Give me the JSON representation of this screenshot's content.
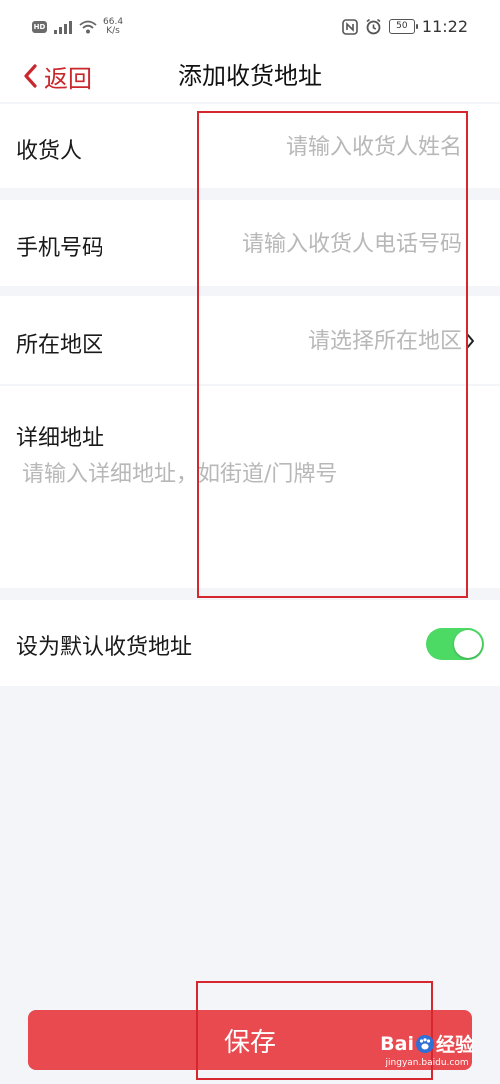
{
  "status_bar": {
    "hd_badge": "HD",
    "network_speed_value": "66.4",
    "network_speed_unit": "K/s",
    "battery": "50",
    "time": "11:22",
    "icons": [
      "hd-icon",
      "signal-icon",
      "wifi-icon",
      "nfc-icon",
      "alarm-icon",
      "battery-icon"
    ]
  },
  "nav": {
    "back_label": "返回",
    "title": "添加收货地址"
  },
  "form": {
    "recipient": {
      "label": "收货人",
      "placeholder": "请输入收货人姓名",
      "value": ""
    },
    "phone": {
      "label": "手机号码",
      "placeholder": "请输入收货人电话号码",
      "value": ""
    },
    "region": {
      "label": "所在地区",
      "placeholder": "请选择所在地区",
      "value": ""
    },
    "detail": {
      "label": "详细地址",
      "placeholder": "请输入详细地址，如街道/门牌号",
      "value": ""
    },
    "default": {
      "label": "设为默认收货地址",
      "enabled": true
    }
  },
  "save_label": "保存",
  "watermark": {
    "logo_left": "Bai",
    "logo_right": "经验",
    "url": "jingyan.baidu.com"
  },
  "colors": {
    "accent": "#c9282d",
    "save_button": "#e84a4f",
    "toggle_on": "#4cd964",
    "annotation": "#d7272e",
    "background": "#f4f5f9"
  }
}
